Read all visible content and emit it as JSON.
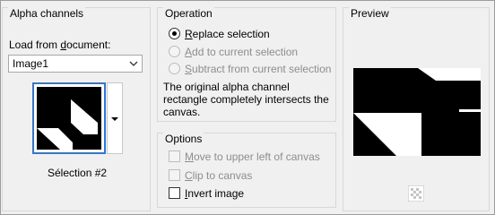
{
  "alpha": {
    "title": "Alpha channels",
    "load_label_pre": "Load from ",
    "load_label_u": "d",
    "load_label_post": "ocument:",
    "document_value": "Image1",
    "selection_name": "Sélection #2"
  },
  "operation": {
    "title": "Operation",
    "replace": {
      "u": "R",
      "rest": "eplace selection",
      "checked": true,
      "disabled": false
    },
    "add": {
      "u": "A",
      "rest": "dd to current selection",
      "checked": false,
      "disabled": true
    },
    "subtract": {
      "u": "S",
      "rest": "ubtract from current selection",
      "checked": false,
      "disabled": true
    },
    "info_line1": "The original alpha channel",
    "info_line2": "rectangle completely intersects the",
    "info_line3": "canvas."
  },
  "options": {
    "title": "Options",
    "move": {
      "u": "M",
      "rest": "ove to upper left of canvas",
      "checked": false,
      "disabled": true
    },
    "clip": {
      "u": "C",
      "rest": "lip to canvas",
      "checked": false,
      "disabled": true
    },
    "invert": {
      "u": "I",
      "rest": "nvert image",
      "checked": false,
      "disabled": false
    }
  },
  "preview": {
    "title": "Preview"
  },
  "colors": {
    "accent": "#2f77d2",
    "disabled_text": "#8d8d8d"
  }
}
